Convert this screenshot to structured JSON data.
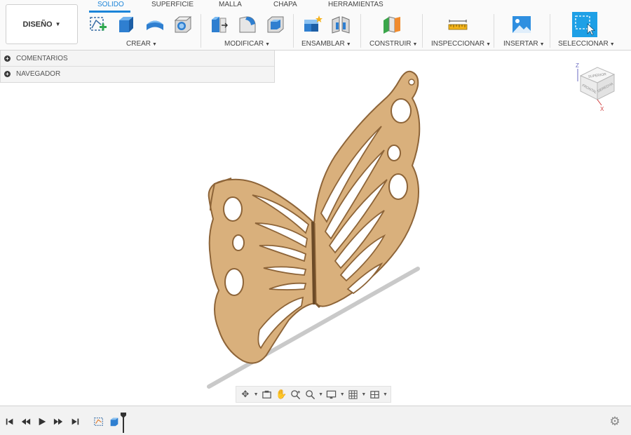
{
  "workspace": {
    "label": "DISEÑO"
  },
  "tabs": [
    {
      "label": "SOLIDO",
      "active": true
    },
    {
      "label": "SUPERFICIE",
      "active": false
    },
    {
      "label": "MALLA",
      "active": false
    },
    {
      "label": "CHAPA",
      "active": false
    },
    {
      "label": "HERRAMIENTAS",
      "active": false
    }
  ],
  "groups": {
    "crear": "CREAR",
    "modificar": "MODIFICAR",
    "ensamblar": "ENSAMBLAR",
    "construir": "CONSTRUIR",
    "inspeccionar": "INSPECCIONAR",
    "insertar": "INSERTAR",
    "seleccionar": "SELECCIONAR"
  },
  "browser": {
    "items": [
      {
        "label": "COMENTARIOS"
      },
      {
        "label": "NAVEGADOR"
      }
    ]
  },
  "viewcube": {
    "axis_z": "Z",
    "axis_x": "X",
    "face_top": "SUPERIOR",
    "face_front": "FRONTAL",
    "face_right": "DERECHA"
  },
  "colors": {
    "accent": "#1b84d8",
    "wood": "#d9b07c",
    "wood_edge": "#a47847",
    "select_blue": "#1ea0e6"
  },
  "icons": {
    "sketch": "create-sketch-icon",
    "extrude": "extrude-icon",
    "revolve": "revolve-icon",
    "shell": "hole-icon",
    "press_pull": "press-pull-icon",
    "fillet": "fillet-icon",
    "shell_mod": "shell-icon",
    "new_component": "new-component-icon",
    "joint": "joint-icon",
    "construct": "offset-plane-icon",
    "measure": "measure-icon",
    "insert": "insert-image-icon",
    "select": "select-icon",
    "settings": "gear-icon"
  }
}
